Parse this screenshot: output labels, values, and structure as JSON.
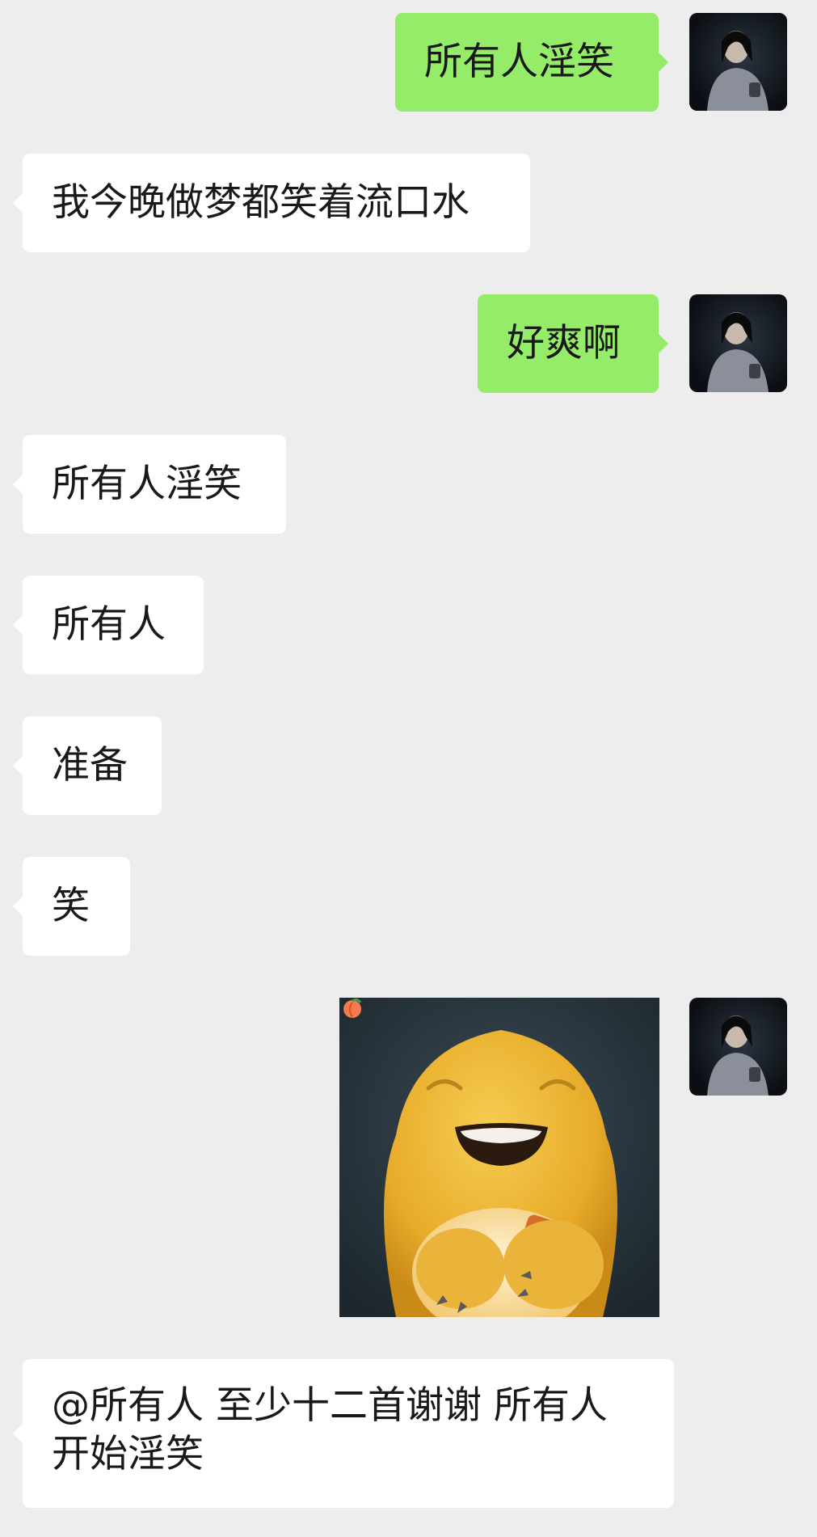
{
  "messages": [
    {
      "side": "out",
      "text": "所有人淫笑"
    },
    {
      "side": "in",
      "text": "我今晚做梦都笑着流口水"
    },
    {
      "side": "out",
      "text": "好爽啊"
    },
    {
      "side": "in",
      "text": "所有人淫笑"
    },
    {
      "side": "in",
      "text": "所有人"
    },
    {
      "side": "in",
      "text": "准备"
    },
    {
      "side": "in",
      "text": "笑"
    },
    {
      "side": "out",
      "type": "sticker",
      "icon": "peach-icon"
    },
    {
      "side": "in",
      "text_line1": "@所有人 至少十二首谢谢 所有人",
      "text_line2": "开始淫笑"
    }
  ],
  "colors": {
    "background": "#ededed",
    "incoming_bubble": "#ffffff",
    "outgoing_bubble": "#95ec69"
  }
}
